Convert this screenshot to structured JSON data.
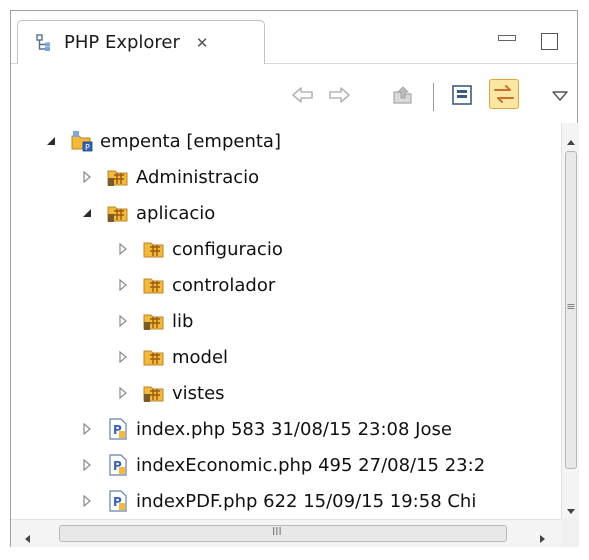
{
  "view": {
    "tab_label": "PHP Explorer",
    "tab_close_glyph": "✕"
  },
  "toolbar": {
    "back": "back-icon",
    "forward": "forward-icon",
    "up": "up-folder-icon",
    "collapse_all": "collapse-all-icon",
    "link_with_editor": "link-with-editor-icon",
    "view_menu": "view-menu-icon"
  },
  "tree": {
    "project": {
      "label": "empenta [empenta]",
      "expanded": true
    },
    "items": [
      {
        "label": "Administracio",
        "icon": "package-folder-icon",
        "expanded": false
      },
      {
        "label": "aplicacio",
        "icon": "package-folder-icon",
        "expanded": true
      },
      {
        "label": "configuracio",
        "icon": "package-folder-icon",
        "expanded": false
      },
      {
        "label": "controlador",
        "icon": "package-folder-icon",
        "expanded": false
      },
      {
        "label": "lib",
        "icon": "package-folder-icon",
        "expanded": false
      },
      {
        "label": "model",
        "icon": "package-folder-icon",
        "expanded": false
      },
      {
        "label": "vistes",
        "icon": "package-folder-icon",
        "expanded": false
      },
      {
        "label": "index.php 583  31/08/15 23:08  Jose",
        "icon": "php-file-icon",
        "expanded": false
      },
      {
        "label": "indexEconomic.php 495  27/08/15 23:2",
        "icon": "php-file-icon",
        "expanded": false
      },
      {
        "label": "indexPDF.php 622  15/09/15 19:58  Chi",
        "icon": "php-file-icon",
        "expanded": false
      }
    ]
  },
  "scrollbars": {
    "vertical_grip_glyph": "≡",
    "horizontal_grip_glyph": "III"
  },
  "colors": {
    "accent_link_toggle": "#fbe7a3",
    "folder_yellow": "#f2b93b",
    "php_blue": "#3b62b5"
  }
}
